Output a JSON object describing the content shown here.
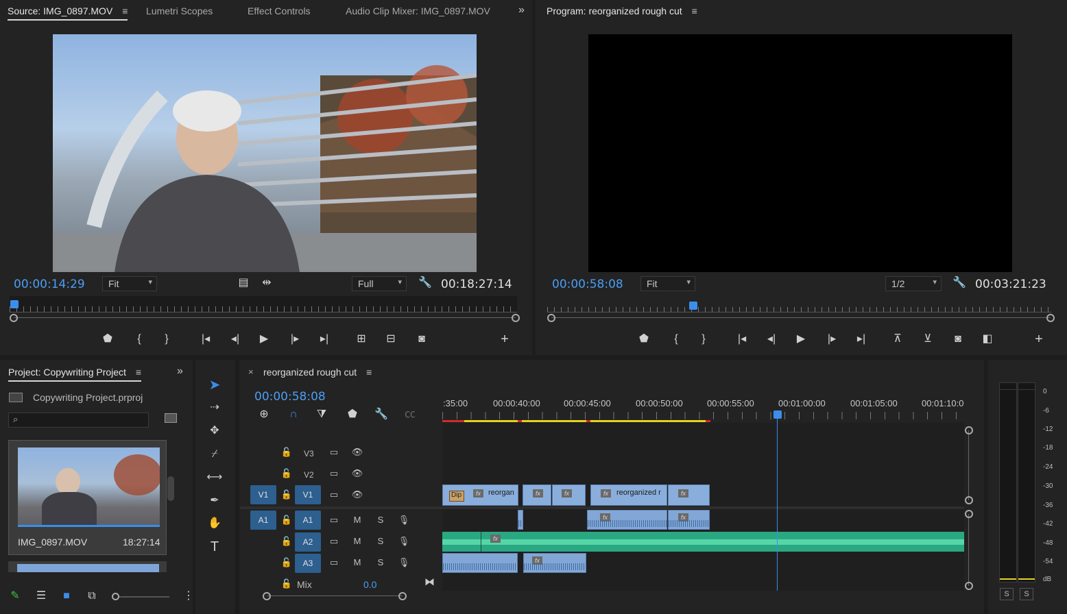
{
  "source_panel": {
    "tabs": [
      "Source: IMG_0897.MOV",
      "Lumetri Scopes",
      "Effect Controls",
      "Audio Clip Mixer: IMG_0897.MOV"
    ],
    "current_time": "00:00:14:29",
    "fit": "Fit",
    "resolution": "Full",
    "duration": "00:18:27:14",
    "playhead_fraction": 0.01
  },
  "program_panel": {
    "title": "Program: reorganized rough cut",
    "current_time": "00:00:58:08",
    "fit": "Fit",
    "resolution": "1/2",
    "duration": "00:03:21:23",
    "playhead_fraction": 0.29
  },
  "project_panel": {
    "title": "Project: Copywriting Project",
    "file": "Copywriting Project.prproj",
    "search_placeholder": "",
    "item_name": "IMG_0897.MOV",
    "item_duration": "18:27:14"
  },
  "timeline": {
    "title": "reorganized rough cut",
    "current_time": "00:00:58:08",
    "time_labels": [
      ":35:00",
      "00:00:40:00",
      "00:00:45:00",
      "00:00:50:00",
      "00:00:55:00",
      "00:01:00:00",
      "00:01:05:00",
      "00:01:10:0"
    ],
    "tracks": {
      "v3": "V3",
      "v2": "V2",
      "v1": "V1",
      "v1_source": "V1",
      "a1": "A1",
      "a1_source": "A1",
      "a2": "A2",
      "a3": "A3"
    },
    "mute_label": "M",
    "solo_label": "S",
    "mix_label": "Mix",
    "mix_value": "0.0",
    "clips": {
      "dip": "Dip",
      "clip1": "reorgan",
      "clip2": "reorganized r"
    }
  },
  "audio_meter": {
    "scale": [
      "0",
      "-6",
      "-12",
      "-18",
      "-24",
      "-30",
      "-36",
      "-42",
      "-48",
      "-54",
      "dB"
    ],
    "solo_left": "S",
    "solo_right": "S"
  },
  "colors": {
    "accent_blue": "#4a9ef5",
    "clip_blue": "#8aaedc",
    "clip_green": "#2aa882",
    "render_yellow": "#e8d21c",
    "render_red": "#d42a2a"
  }
}
